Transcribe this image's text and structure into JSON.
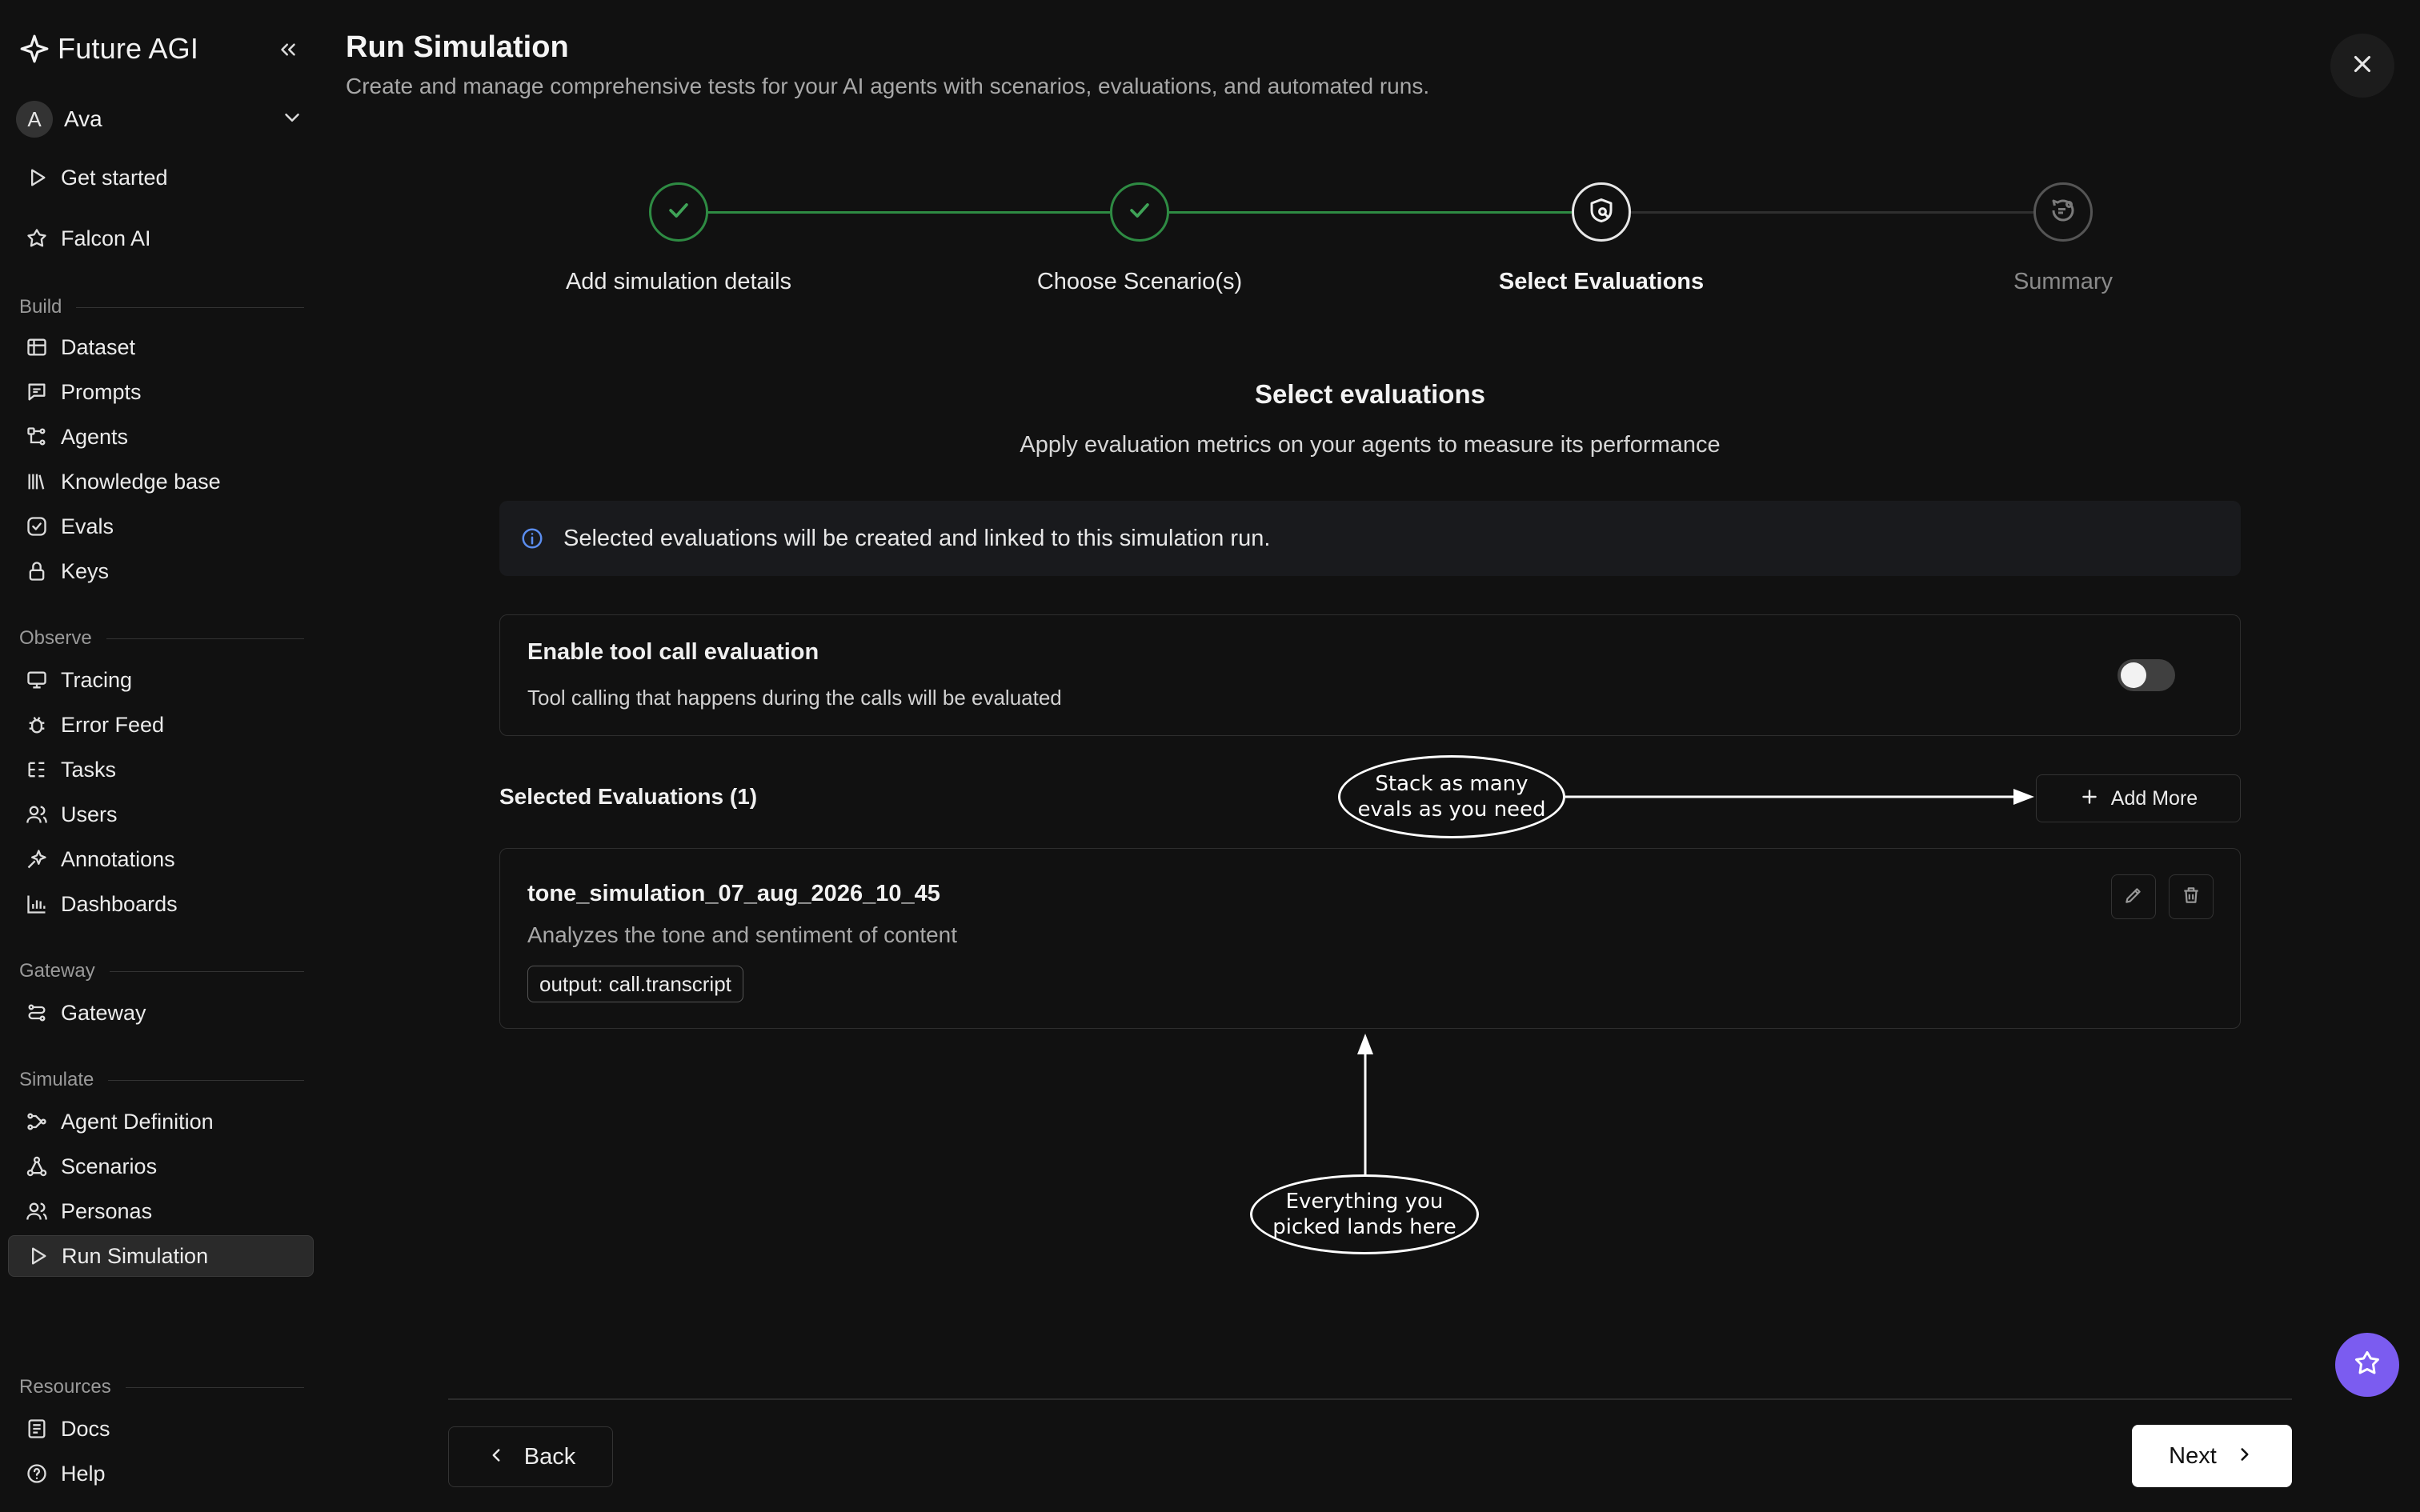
{
  "brand": {
    "name": "Future AGI"
  },
  "user": {
    "initial": "A",
    "name": "Ava"
  },
  "sidebar": {
    "top_items": [
      {
        "label": "Get started",
        "icon": "play-icon"
      },
      {
        "label": "Falcon AI",
        "icon": "falcon-icon"
      }
    ],
    "sections": {
      "build": "Build",
      "observe": "Observe",
      "gateway": "Gateway",
      "simulate": "Simulate",
      "resources": "Resources"
    },
    "build_items": [
      "Dataset",
      "Prompts",
      "Agents",
      "Knowledge base",
      "Evals",
      "Keys"
    ],
    "observe_items": [
      "Tracing",
      "Error Feed",
      "Tasks",
      "Users",
      "Annotations",
      "Dashboards"
    ],
    "gateway_items": [
      "Gateway"
    ],
    "simulate_items": [
      "Agent Definition",
      "Scenarios",
      "Personas",
      "Run Simulation"
    ],
    "resources_items": [
      "Docs",
      "Help"
    ],
    "active_item": "Run Simulation"
  },
  "header": {
    "title": "Run Simulation",
    "subtitle": "Create and manage comprehensive tests for your AI agents with scenarios, evaluations, and automated runs."
  },
  "stepper": {
    "steps": [
      {
        "label": "Add simulation details",
        "state": "done"
      },
      {
        "label": "Choose Scenario(s)",
        "state": "done"
      },
      {
        "label": "Select Evaluations",
        "state": "current"
      },
      {
        "label": "Summary",
        "state": "todo"
      }
    ]
  },
  "content": {
    "title": "Select evaluations",
    "subtitle": "Apply evaluation metrics on your agents to measure its performance",
    "info": "Selected evaluations will be created and linked to this simulation run.",
    "toggle": {
      "title": "Enable tool call evaluation",
      "description": "Tool calling that happens during the calls will be evaluated",
      "enabled": false
    },
    "selected_title": "Selected Evaluations (1)",
    "add_more_label": "Add More",
    "evaluations": [
      {
        "name": "tone_simulation_07_aug_2026_10_45",
        "description": "Analyzes the tone and sentiment of content",
        "chip": "output: call.transcript"
      }
    ]
  },
  "annotations": {
    "add_more_line1": "Stack as many",
    "add_more_line2": "evals as you need",
    "cards_line1": "Everything you",
    "cards_line2": "picked lands here"
  },
  "footer": {
    "back_label": "Back",
    "next_label": "Next"
  },
  "colors": {
    "background": "#111111",
    "done_green": "#2e8b43",
    "fab_purple": "#7b5cf0",
    "info_blue": "#5b8def"
  }
}
